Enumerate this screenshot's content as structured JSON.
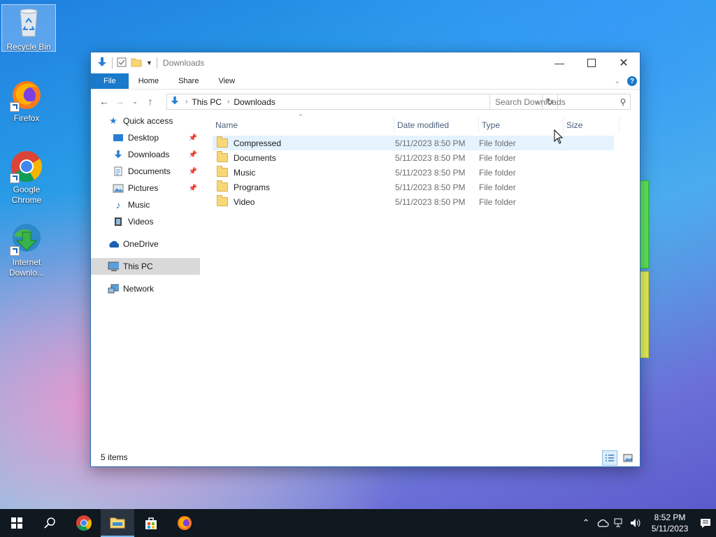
{
  "desktop": {
    "icons": [
      {
        "label": "Recycle Bin"
      },
      {
        "label": "Firefox"
      },
      {
        "label": "Google Chrome"
      },
      {
        "label": "Internet Downlo..."
      }
    ]
  },
  "window": {
    "title": "Downloads",
    "ribbon_tabs": [
      "File",
      "Home",
      "Share",
      "View"
    ],
    "address": {
      "segments": [
        "This PC",
        "Downloads"
      ]
    },
    "search_placeholder": "Search Downloads",
    "nav": {
      "quick_access": "Quick access",
      "pinned": [
        "Desktop",
        "Downloads",
        "Documents",
        "Pictures"
      ],
      "unpinned": [
        "Music",
        "Videos"
      ],
      "onedrive": "OneDrive",
      "this_pc": "This PC",
      "network": "Network"
    },
    "columns": [
      "Name",
      "Date modified",
      "Type",
      "Size"
    ],
    "files": [
      {
        "name": "Compressed",
        "date": "5/11/2023 8:50 PM",
        "type": "File folder"
      },
      {
        "name": "Documents",
        "date": "5/11/2023 8:50 PM",
        "type": "File folder"
      },
      {
        "name": "Music",
        "date": "5/11/2023 8:50 PM",
        "type": "File folder"
      },
      {
        "name": "Programs",
        "date": "5/11/2023 8:50 PM",
        "type": "File folder"
      },
      {
        "name": "Video",
        "date": "5/11/2023 8:50 PM",
        "type": "File folder"
      }
    ],
    "status": "5 items"
  },
  "taskbar": {
    "time": "8:52 PM",
    "date": "5/11/2023"
  }
}
